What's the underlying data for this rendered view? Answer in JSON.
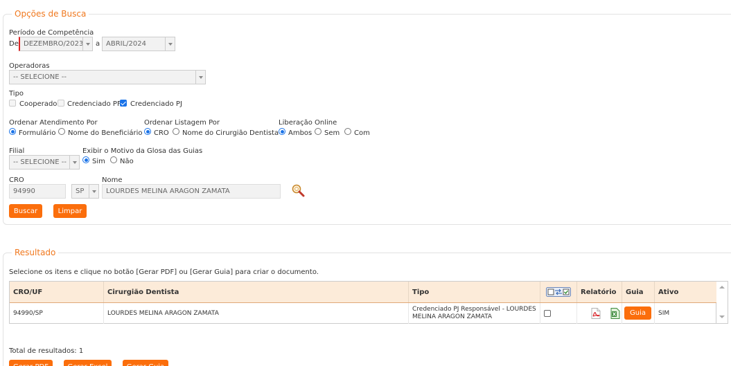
{
  "search": {
    "legend": "Opções de Busca",
    "periodo_label": "Período de Competência",
    "de_label": "De",
    "de_value": "DEZEMBRO/2023",
    "a_label": "a",
    "ate_value": "ABRIL/2024",
    "operadoras_label": "Operadoras",
    "operadoras_value": "-- SELECIONE --",
    "tipo_label": "Tipo",
    "tipo_options": [
      "Cooperado",
      "Credenciado PF",
      "Credenciado PJ"
    ],
    "ordenar_atendimento_label": "Ordenar Atendimento Por",
    "ordenar_atendimento_options": [
      "Formulário",
      "Nome do Beneficiário"
    ],
    "ordenar_listagem_label": "Ordenar Listagem Por",
    "ordenar_listagem_options": [
      "CRO",
      "Nome do Cirurgião Dentista"
    ],
    "liberacao_label": "Liberação Online",
    "liberacao_options": [
      "Ambos",
      "Sem",
      "Com"
    ],
    "filial_label": "Filial",
    "filial_value": "-- SELECIONE --",
    "glosa_label": "Exibir o Motivo da Glosa das Guias",
    "glosa_options": [
      "Sim",
      "Não"
    ],
    "cro_label": "CRO",
    "cro_value": "94990",
    "uf_value": "SP",
    "nome_label": "Nome",
    "nome_value": "LOURDES MELINA ARAGON ZAMATA",
    "buscar_label": "Buscar",
    "limpar_label": "Limpar"
  },
  "result": {
    "legend": "Resultado",
    "instructions": "Selecione os itens e clique no botão [Gerar PDF] ou [Gerar Guia] para criar o documento.",
    "columns": [
      "CRO/UF",
      "Cirurgião Dentista",
      "Tipo",
      "",
      "Relatório",
      "Guia",
      "Ativo"
    ],
    "rows": [
      {
        "cro_uf": "94990/SP",
        "dentista": "LOURDES MELINA ARAGON ZAMATA",
        "tipo_line1": "Credenciado PJ Responsável - LOURDES",
        "tipo_line2": "MELINA ARAGON ZAMATA",
        "guia_button": "Guia",
        "ativo": "SIM"
      }
    ],
    "total": "Total de resultados: 1",
    "bottom_buttons": [
      "Gerar PDF",
      "Gerar Excel",
      "Gerar Guia"
    ]
  },
  "colors": {
    "accent": "#fb6e0c",
    "legend": "#f0781e",
    "header_bg": "#fcebd9",
    "radio": "#1a73e8"
  },
  "icons": [
    "pdf-icon",
    "excel-icon",
    "magnifier-icon",
    "toggle-select-icon"
  ]
}
